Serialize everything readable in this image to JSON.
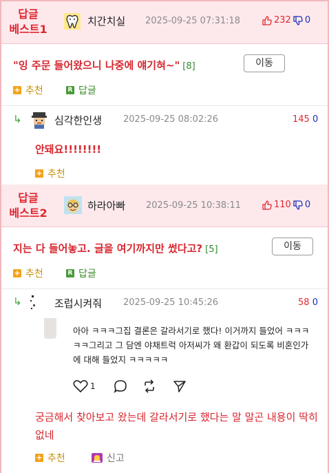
{
  "best_comments": [
    {
      "label": "답글 베스트1",
      "label_lines": [
        "답글",
        "베스트1"
      ],
      "nickname": "치간치실",
      "avatar_icon": "tooth-icon",
      "date": "2025-09-25 07:31:18",
      "up_count": "232",
      "down_count": "0",
      "text": "\"잉 주문 들어왔으니 나중에 얘기혀~\"",
      "reply_count": "[8]",
      "move_label": "이동",
      "recommend_label": "추천",
      "reply_label": "답글",
      "reply": {
        "nickname": "심각한인생",
        "avatar_icon": "pixel-face-icon",
        "date": "2025-09-25 08:02:26",
        "score": "145",
        "down": "0",
        "text": "안돼요!!!!!!!!",
        "recommend_label": "추천"
      }
    },
    {
      "label": "답글 베스트2",
      "label_lines": [
        "답글",
        "베스트2"
      ],
      "nickname": "하라아빠",
      "avatar_icon": "face-glasses-icon",
      "date": "2025-09-25 10:38:11",
      "up_count": "110",
      "down_count": "0",
      "text": "지는 다 들어놓고. 글을 여기까지만 썼다고?",
      "reply_count": "[5]",
      "move_label": "이동",
      "recommend_label": "추천",
      "reply_label": "답글",
      "reply": {
        "nickname": "조럽시켜줘",
        "avatar_icon": "tiny-figure-icon",
        "date": "2025-09-25 10:45:26",
        "score": "58",
        "down": "0",
        "quote_text": "아아 ㅋㅋㅋ그집 결론은 갈라서기로 했다! 이거까지 들었어 ㅋㅋㅋㅋㅋ그리고 그 담엔 야채트럭 아저씨가 왜 환갑이 되도록 비혼인가에 대해 들었지 ㅋㅋㅋㅋㅋ",
        "quote_like_count": "1",
        "text": "궁금해서 찾아보고 왔는데 갈라서기로 했다는 말 말곤 내용이 딱히 없네",
        "recommend_label": "추천",
        "report_label": "신고"
      }
    }
  ],
  "colors": {
    "accent_red": "#d6262e",
    "best_bg": "#fde9ec",
    "border_pink": "#f2b8bd",
    "count_green": "#2f8a2f",
    "down_blue": "#1a2fb8",
    "recommend_orange": "#f2a21e"
  }
}
